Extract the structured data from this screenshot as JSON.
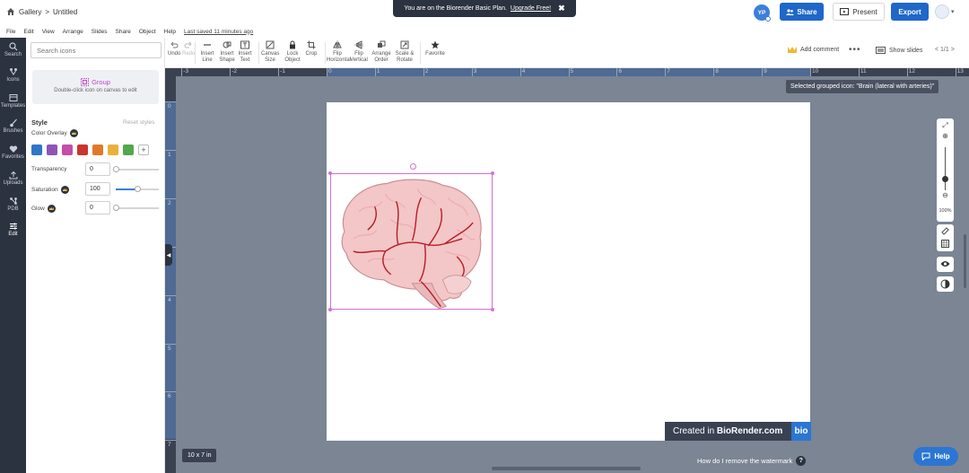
{
  "header": {
    "gallery_label": "Gallery",
    "separator": ">",
    "doc_title": "Untitled",
    "banner_text": "You are on the Biorender Basic Plan.",
    "banner_link": "Upgrade Free!",
    "avatar_initials": "YP",
    "share_label": "Share",
    "present_label": "Present",
    "export_label": "Export"
  },
  "menu": {
    "items": [
      "File",
      "Edit",
      "View",
      "Arrange",
      "Slides",
      "Share",
      "Object",
      "Help"
    ],
    "last_saved": "Last saved 11 minutes ago"
  },
  "rail": {
    "items": [
      {
        "label": "Search",
        "icon": "search-icon"
      },
      {
        "label": "Icons",
        "icon": "icons-icon"
      },
      {
        "label": "Templates",
        "icon": "templates-icon"
      },
      {
        "label": "Brushes",
        "icon": "brush-icon"
      },
      {
        "label": "Favorites",
        "icon": "heart-icon"
      },
      {
        "label": "Uploads",
        "icon": "upload-icon"
      },
      {
        "label": "PDB",
        "icon": "pdb-icon"
      },
      {
        "label": "Edit",
        "icon": "edit-icon"
      }
    ]
  },
  "panel": {
    "search_placeholder": "Search icons",
    "group_title": "Group",
    "group_sub": "Double-click icon on canvas to edit",
    "style_label": "Style",
    "reset_label": "Reset styles",
    "overlay_label": "Color Overlay",
    "swatches": [
      "#2f76c7",
      "#8e55b7",
      "#c24fa8",
      "#c9352f",
      "#e07a2a",
      "#e9b13a",
      "#53a84a"
    ],
    "transparency_label": "Transparency",
    "transparency_value": "0",
    "transparency_level": 0,
    "saturation_label": "Saturation",
    "saturation_value": "100",
    "saturation_level": 0.5,
    "glow_label": "Glow",
    "glow_value": "0",
    "glow_level": 0
  },
  "toolbar": {
    "undo": "Undo",
    "redo": "Redo",
    "insert_line": "Insert Line",
    "insert_shape": "Insert Shape",
    "insert_text": "Insert Text",
    "canvas_size": "Canvas Size",
    "lock_object": "Lock Object",
    "crop": "Crop",
    "flip_h": "Flip Horizontal",
    "flip_v": "Flip Vertical",
    "arrange_order": "Arrange Order",
    "scale_rotate": "Scale & Rotate",
    "favorite": "Favorite",
    "add_comment": "Add comment",
    "show_slides": "Show slides",
    "pager": "< 1/1 >"
  },
  "canvas": {
    "ruler_top": [
      "-3",
      "-2",
      "-1",
      "0",
      "1",
      "2",
      "3",
      "4",
      "5",
      "6",
      "7",
      "8",
      "9",
      "10",
      "11",
      "12",
      "13"
    ],
    "ruler_left": [
      "0",
      "1",
      "2",
      "3",
      "4",
      "5",
      "6",
      "7"
    ],
    "selection_info": "Selected grouped icon: \"Brain (lateral with arteries)\"",
    "watermark_prefix": "Created in",
    "watermark_brand": "BioRender.com",
    "watermark_badge": "bio",
    "size_chip": "10 x 7 in",
    "remove_wm": "How do I remove the watermark",
    "help_label": "Help",
    "zoom_pct": "100%"
  }
}
